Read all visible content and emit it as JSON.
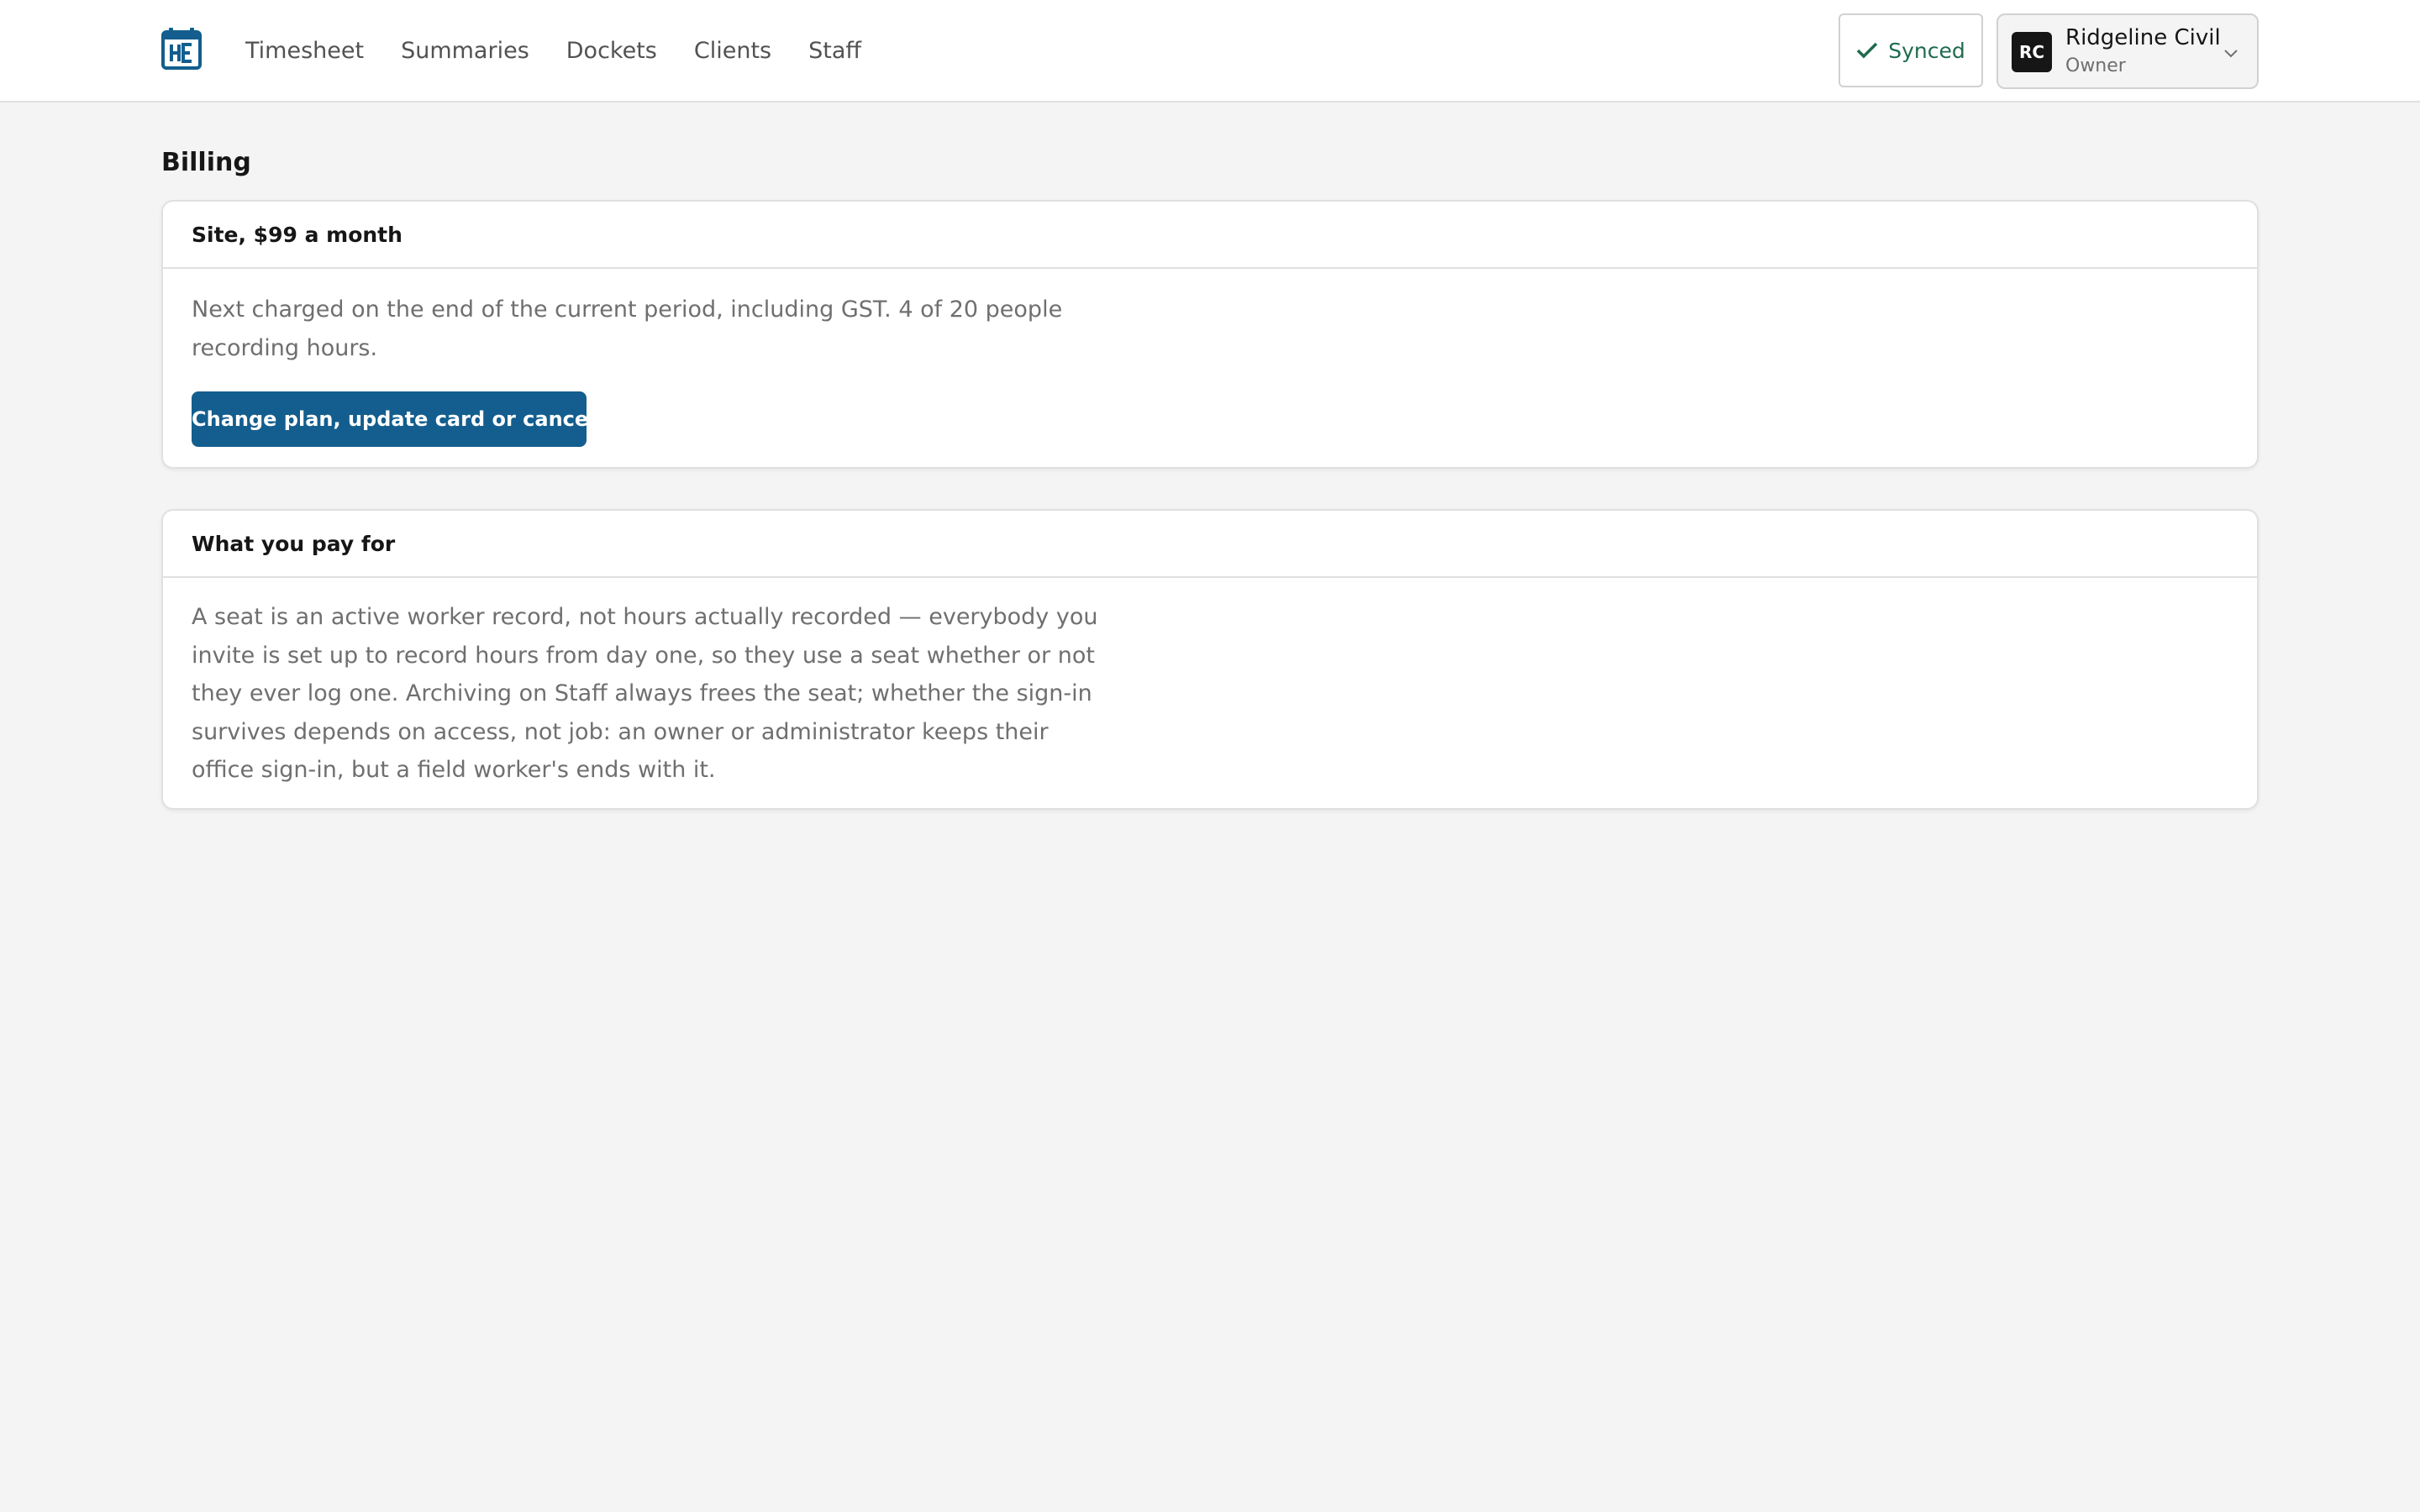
{
  "header": {
    "logo_icon": "calendar-logo-icon",
    "nav": [
      "Timesheet",
      "Summaries",
      "Dockets",
      "Clients",
      "Staff"
    ],
    "sync_status": {
      "label": "Synced",
      "icon": "check-icon",
      "color": "#1e6b4e"
    },
    "account": {
      "initials": "RC",
      "name": "Ridgeline Civil",
      "role": "Owner",
      "icon": "chevron-down-icon"
    }
  },
  "main": {
    "title": "Billing",
    "plan_card": {
      "heading": "Site, $99 a month",
      "description": "Next charged on the end of the current period, including GST. 4 of 20 people recording hours.",
      "button": "Change plan, update card or cancel"
    },
    "info_card": {
      "heading": "What you pay for",
      "description": "A seat is an active worker record, not hours actually recorded — everybody you invite is set up to record hours from day one, so they use a seat whether or not they ever log one. Archiving on Staff always frees the seat; whether the sign-in survives depends on access, not job: an owner or administrator keeps their office sign-in, but a field worker's ends with it."
    }
  },
  "colors": {
    "brand": "#135e8e",
    "background": "#f4f4f4",
    "surface": "#ffffff",
    "success": "#1e6b4e"
  }
}
